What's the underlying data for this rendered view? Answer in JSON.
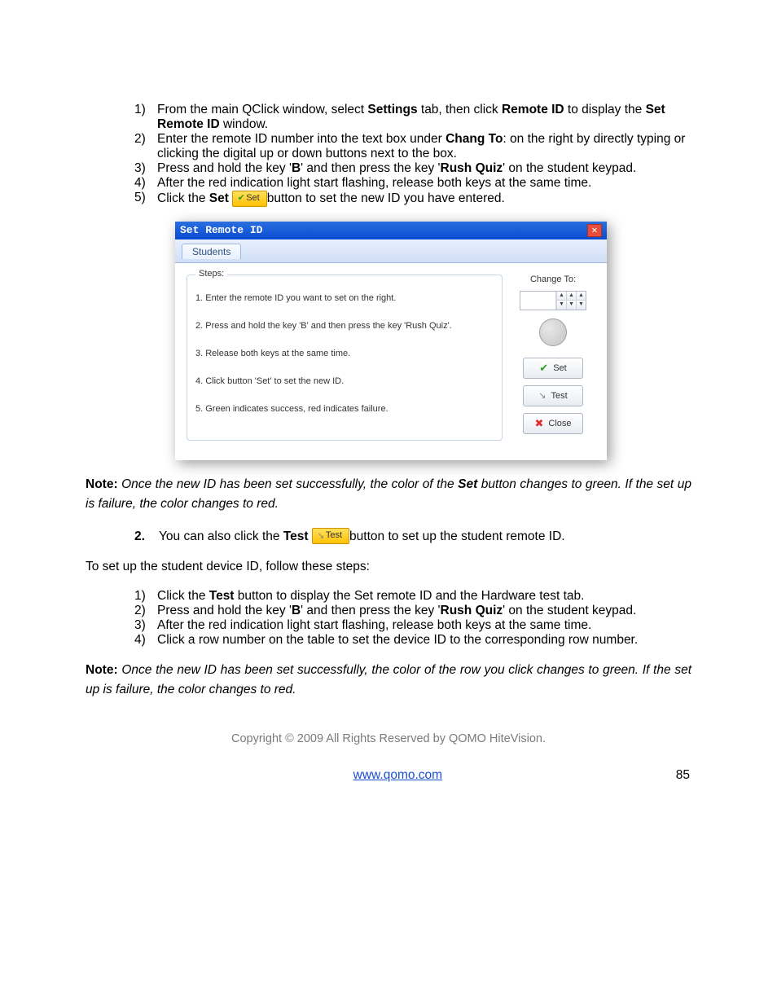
{
  "steps1": [
    {
      "n": "1)",
      "parts": [
        "From the main QClick window, select ",
        {
          "b": "Settings"
        },
        " tab, then click ",
        {
          "b": "Remote ID"
        },
        " to display the ",
        {
          "b": "Set Remote ID"
        },
        " window."
      ]
    },
    {
      "n": "2)",
      "parts": [
        "Enter the remote ID number into the text box under ",
        {
          "b": "Chang To"
        },
        ": on the right by directly typing or clicking the digital up or down buttons next to the box."
      ]
    },
    {
      "n": "3)",
      "parts": [
        "Press and hold the key '",
        {
          "b": "B"
        },
        "' and then press the key '",
        {
          "b": "Rush Quiz"
        },
        "' on the student keypad."
      ]
    },
    {
      "n": "4)",
      "parts": [
        "After the red indication light start flashing, release both keys at the same time."
      ]
    },
    {
      "n": "5)",
      "parts": [
        "Click the ",
        {
          "b": "Set"
        },
        " ",
        {
          "btn": {
            "icon": "✔",
            "icolor": "#2a9d2a",
            "label": "Set"
          }
        },
        "button to set the new ID you have entered."
      ]
    }
  ],
  "dialog": {
    "title": "Set Remote ID",
    "tab": "Students",
    "steps_title": "Steps:",
    "lines": [
      "1. Enter the remote ID you want to set on the right.",
      "2. Press and hold the key 'B' and then press the key 'Rush Quiz'.",
      "3. Release both keys at the same time.",
      "4. Click button 'Set' to set the new ID.",
      "5. Green indicates success, red indicates failure."
    ],
    "change_to": "Change To:",
    "buttons": {
      "set": "Set",
      "test": "Test",
      "close": "Close"
    }
  },
  "note1": {
    "label": "Note:",
    "body_parts": [
      " Once the new ID has been set successfully, the color of the ",
      {
        "b": "Set"
      },
      " button changes to green. If the set up is failure, the color changes to red."
    ]
  },
  "item2": {
    "n": "2.",
    "parts": [
      "You can also click the ",
      {
        "b": "Test"
      },
      " ",
      {
        "btn": {
          "icon": "↘",
          "icolor": "#888",
          "label": "Test"
        }
      },
      "button to set up the student remote ID."
    ]
  },
  "plain": "To set up the student device ID, follow these steps:",
  "steps2": [
    {
      "n": "1)",
      "parts": [
        "Click the ",
        {
          "b": "Test"
        },
        " button to display the Set remote ID and the Hardware test tab."
      ]
    },
    {
      "n": "2)",
      "parts": [
        "Press and hold the key '",
        {
          "b": "B"
        },
        "' and then press the key '",
        {
          "b": "Rush Quiz"
        },
        "' on the student keypad."
      ]
    },
    {
      "n": "3)",
      "parts": [
        "After the red indication light start flashing, release both keys at the same time."
      ]
    },
    {
      "n": "4)",
      "parts": [
        "Click a row number on the table to set the device ID to the corresponding row number."
      ]
    }
  ],
  "note2": {
    "label": "Note:",
    "body_parts": [
      " Once the new ID has been set successfully, the color of the row you click changes to green. If the set up is failure, the color changes to red."
    ]
  },
  "footer": {
    "copyright": "Copyright © 2009 All Rights Reserved by QOMO HiteVision.",
    "url": "www.qomo.com",
    "page": "85"
  }
}
